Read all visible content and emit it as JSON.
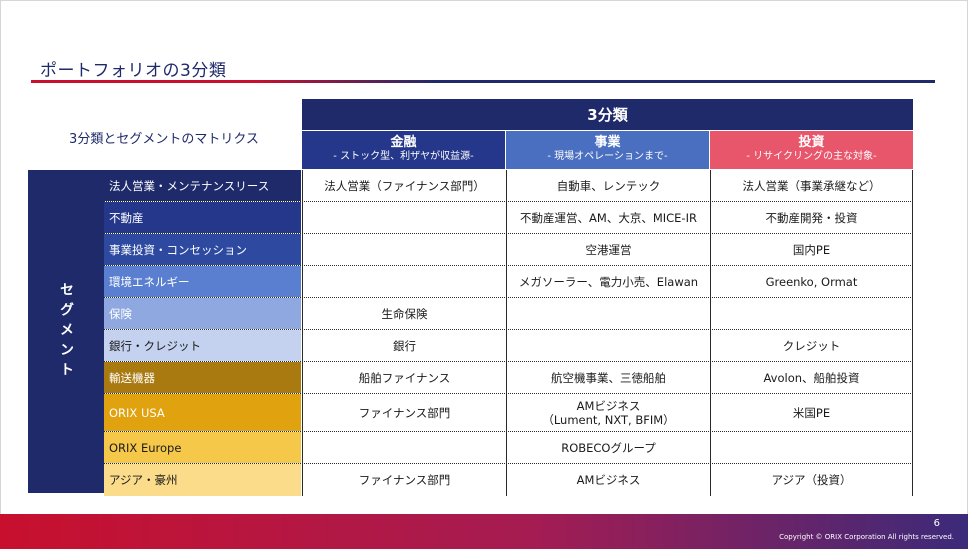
{
  "title": "ポートフォリオの3分類",
  "matrix_label": "3分類とセグメントのマトリクス",
  "classification_header": "3分類",
  "columns": [
    {
      "main": "金融",
      "sub": "- ストック型、利ザヤが収益源-"
    },
    {
      "main": "事業",
      "sub": "- 現場オペレーションまで-"
    },
    {
      "main": "投資",
      "sub": "- リサイクリングの主な対象-"
    }
  ],
  "segment_header": "セグメント",
  "rows": [
    {
      "segment": "法人営業・メンテナンスリース",
      "cells": [
        "法人営業（ファイナンス部門）",
        "自動車、レンテック",
        "法人営業（事業承継など）"
      ]
    },
    {
      "segment": "不動産",
      "cells": [
        "",
        "不動産運営、AM、大京、MICE-IR",
        "不動産開発・投資"
      ]
    },
    {
      "segment": "事業投資・コンセッション",
      "cells": [
        "",
        "空港運営",
        "国内PE"
      ]
    },
    {
      "segment": "環境エネルギー",
      "cells": [
        "",
        "メガソーラー、電力小売、Elawan",
        "Greenko, Ormat"
      ]
    },
    {
      "segment": "保険",
      "cells": [
        "生命保険",
        "",
        ""
      ]
    },
    {
      "segment": "銀行・クレジット",
      "cells": [
        "銀行",
        "",
        "クレジット"
      ]
    },
    {
      "segment": "輸送機器",
      "cells": [
        "船舶ファイナンス",
        "航空機事業、三徳船舶",
        "Avolon、船舶投資"
      ]
    },
    {
      "segment": "ORIX USA",
      "cells": [
        "ファイナンス部門",
        "AMビジネス\n（Lument, NXT, BFIM）",
        "米国PE"
      ]
    },
    {
      "segment": "ORIX Europe",
      "cells": [
        "",
        "ROBECOグループ",
        ""
      ]
    },
    {
      "segment": "アジア・豪州",
      "cells": [
        "ファイナンス部門",
        "AMビジネス",
        "アジア（投資）"
      ]
    }
  ],
  "footer": {
    "page": "6",
    "copyright": "Copyright © ORIX Corporation All rights reserved."
  }
}
